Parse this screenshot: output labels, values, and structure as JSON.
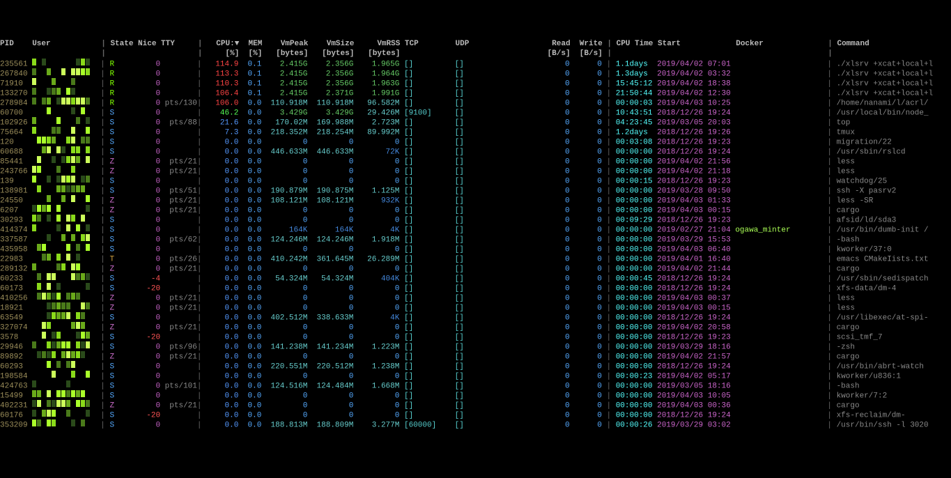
{
  "columns": [
    "PID",
    "User",
    "State",
    "Nice",
    "TTY",
    "CPU:▼",
    "MEM",
    "VmPeak",
    "VmSize",
    "VmRSS",
    "TCP",
    "UDP",
    "Read",
    "Write",
    "CPU Time",
    "Start",
    "Docker",
    "Command"
  ],
  "subheaders": {
    "cpu": "[%]",
    "mem": "[%]",
    "vmpeak": "[bytes]",
    "vmsize": "[bytes]",
    "vmrss": "[bytes]",
    "read": "[B/s]",
    "write": "[B/s]"
  },
  "rows": [
    {
      "pid": "235561",
      "state": "R",
      "nice": "0",
      "tty": "",
      "cpu": "114.9",
      "cpuClass": "cpu-hi",
      "mem": "0.1",
      "vmpeak": "2.415G",
      "vmsize": "2.356G",
      "vmrss": "1.965G",
      "tcp": "[]",
      "udp": "[]",
      "read": "0",
      "write": "0",
      "cputime": "1.1days",
      "start": "2019/04/02 07:01",
      "docker": "",
      "cmd": "./xlsrv +xcat+local+l"
    },
    {
      "pid": "267840",
      "state": "R",
      "nice": "0",
      "tty": "",
      "cpu": "113.3",
      "cpuClass": "cpu-hi",
      "mem": "0.1",
      "vmpeak": "2.415G",
      "vmsize": "2.356G",
      "vmrss": "1.964G",
      "tcp": "[]",
      "udp": "[]",
      "read": "0",
      "write": "0",
      "cputime": "1.3days",
      "start": "2019/04/02 03:32",
      "docker": "",
      "cmd": "./xlsrv +xcat+local+l"
    },
    {
      "pid": "71910",
      "state": "R",
      "nice": "0",
      "tty": "",
      "cpu": "110.3",
      "cpuClass": "cpu-hi",
      "mem": "0.1",
      "vmpeak": "2.415G",
      "vmsize": "2.356G",
      "vmrss": "1.963G",
      "tcp": "[]",
      "udp": "[]",
      "read": "0",
      "write": "0",
      "cputime": "15:45:12",
      "start": "2019/04/02 18:38",
      "docker": "",
      "cmd": "./xlsrv +xcat+local+l"
    },
    {
      "pid": "133270",
      "state": "R",
      "nice": "0",
      "tty": "",
      "cpu": "106.4",
      "cpuClass": "cpu-hi",
      "mem": "0.1",
      "vmpeak": "2.415G",
      "vmsize": "2.371G",
      "vmrss": "1.991G",
      "tcp": "[]",
      "udp": "[]",
      "read": "0",
      "write": "0",
      "cputime": "21:50:44",
      "start": "2019/04/02 12:30",
      "docker": "",
      "cmd": "./xlsrv +xcat+local+l"
    },
    {
      "pid": "278984",
      "state": "R",
      "nice": "0",
      "tty": "pts/130",
      "cpu": "106.0",
      "cpuClass": "cpu-hi",
      "mem": "0.0",
      "vmpeak": "110.918M",
      "vmsize": "110.918M",
      "vmrss": "96.582M",
      "tcp": "[]",
      "udp": "[]",
      "read": "0",
      "write": "0",
      "cputime": "00:00:03",
      "start": "2019/04/03 10:25",
      "docker": "",
      "cmd": "/home/nanami/l/acrl/"
    },
    {
      "pid": "60700",
      "state": "S",
      "nice": "0",
      "tty": "",
      "cpu": "46.2",
      "cpuClass": "cpu-md",
      "mem": "0.0",
      "vmpeak": "3.429G",
      "vmsize": "3.429G",
      "vmrss": "29.426M",
      "tcp": "[9100]",
      "udp": "[]",
      "read": "0",
      "write": "0",
      "cputime": "10:43:51",
      "start": "2018/12/26 19:24",
      "docker": "",
      "cmd": "/usr/local/bin/node_"
    },
    {
      "pid": "102926",
      "state": "S",
      "nice": "0",
      "tty": "pts/88",
      "cpu": "21.6",
      "cpuClass": "cpu-lo",
      "mem": "0.0",
      "vmpeak": "170.02M",
      "vmsize": "169.988M",
      "vmrss": "2.723M",
      "tcp": "[]",
      "udp": "[]",
      "read": "0",
      "write": "0",
      "cputime": "04:23:45",
      "start": "2019/03/05 20:03",
      "docker": "",
      "cmd": "top"
    },
    {
      "pid": "75664",
      "state": "S",
      "nice": "0",
      "tty": "",
      "cpu": "7.3",
      "cpuClass": "cpu-lo",
      "mem": "0.0",
      "vmpeak": "218.352M",
      "vmsize": "218.254M",
      "vmrss": "89.992M",
      "tcp": "[]",
      "udp": "[]",
      "read": "0",
      "write": "0",
      "cputime": "1.2days",
      "start": "2018/12/26 19:26",
      "docker": "",
      "cmd": "tmux"
    },
    {
      "pid": "120",
      "state": "S",
      "nice": "0",
      "tty": "",
      "cpu": "0.0",
      "cpuClass": "cpu-lo",
      "mem": "0.0",
      "vmpeak": "0",
      "vmsize": "0",
      "vmrss": "0",
      "tcp": "[]",
      "udp": "[]",
      "read": "0",
      "write": "0",
      "cputime": "00:03:08",
      "start": "2018/12/26 19:23",
      "docker": "",
      "cmd": "migration/22"
    },
    {
      "pid": "60688",
      "state": "S",
      "nice": "0",
      "tty": "",
      "cpu": "0.0",
      "cpuClass": "cpu-lo",
      "mem": "0.0",
      "vmpeak": "446.633M",
      "vmsize": "446.633M",
      "vmrss": "72K",
      "tcp": "[]",
      "udp": "[]",
      "read": "0",
      "write": "0",
      "cputime": "00:00:00",
      "start": "2018/12/26 19:24",
      "docker": "",
      "cmd": "/usr/sbin/rslcd"
    },
    {
      "pid": "85441",
      "state": "Z",
      "nice": "0",
      "tty": "pts/21",
      "cpu": "0.0",
      "cpuClass": "cpu-lo",
      "mem": "0.0",
      "vmpeak": "0",
      "vmsize": "0",
      "vmrss": "0",
      "tcp": "[]",
      "udp": "[]",
      "read": "0",
      "write": "0",
      "cputime": "00:00:00",
      "start": "2019/04/02 21:56",
      "docker": "",
      "cmd": "less"
    },
    {
      "pid": "243766",
      "state": "Z",
      "nice": "0",
      "tty": "pts/21",
      "cpu": "0.0",
      "cpuClass": "cpu-lo",
      "mem": "0.0",
      "vmpeak": "0",
      "vmsize": "0",
      "vmrss": "0",
      "tcp": "[]",
      "udp": "[]",
      "read": "0",
      "write": "0",
      "cputime": "00:00:00",
      "start": "2019/04/02 21:18",
      "docker": "",
      "cmd": "less"
    },
    {
      "pid": "139",
      "state": "S",
      "nice": "0",
      "tty": "",
      "cpu": "0.0",
      "cpuClass": "cpu-lo",
      "mem": "0.0",
      "vmpeak": "0",
      "vmsize": "0",
      "vmrss": "0",
      "tcp": "[]",
      "udp": "[]",
      "read": "0",
      "write": "0",
      "cputime": "00:00:15",
      "start": "2018/12/26 19:23",
      "docker": "",
      "cmd": "watchdog/25"
    },
    {
      "pid": "138981",
      "state": "S",
      "nice": "0",
      "tty": "pts/51",
      "cpu": "0.0",
      "cpuClass": "cpu-lo",
      "mem": "0.0",
      "vmpeak": "190.879M",
      "vmsize": "190.875M",
      "vmrss": "1.125M",
      "tcp": "[]",
      "udp": "[]",
      "read": "0",
      "write": "0",
      "cputime": "00:00:00",
      "start": "2019/03/28 09:50",
      "docker": "",
      "cmd": "ssh -X pasrv2"
    },
    {
      "pid": "24550",
      "state": "Z",
      "nice": "0",
      "tty": "pts/21",
      "cpu": "0.0",
      "cpuClass": "cpu-lo",
      "mem": "0.0",
      "vmpeak": "108.121M",
      "vmsize": "108.121M",
      "vmrss": "932K",
      "tcp": "[]",
      "udp": "[]",
      "read": "0",
      "write": "0",
      "cputime": "00:00:00",
      "start": "2019/04/03 01:33",
      "docker": "",
      "cmd": "less -SR"
    },
    {
      "pid": "6207",
      "state": "Z",
      "nice": "0",
      "tty": "pts/21",
      "cpu": "0.0",
      "cpuClass": "cpu-lo",
      "mem": "0.0",
      "vmpeak": "0",
      "vmsize": "0",
      "vmrss": "0",
      "tcp": "[]",
      "udp": "[]",
      "read": "0",
      "write": "0",
      "cputime": "00:00:00",
      "start": "2019/04/03 00:15",
      "docker": "",
      "cmd": "cargo"
    },
    {
      "pid": "30293",
      "state": "S",
      "nice": "0",
      "tty": "",
      "cpu": "0.0",
      "cpuClass": "cpu-lo",
      "mem": "0.0",
      "vmpeak": "0",
      "vmsize": "0",
      "vmrss": "0",
      "tcp": "[]",
      "udp": "[]",
      "read": "0",
      "write": "0",
      "cputime": "00:09:29",
      "start": "2018/12/26 19:23",
      "docker": "",
      "cmd": "afsid/ld/sda3"
    },
    {
      "pid": "414374",
      "state": "S",
      "nice": "0",
      "tty": "",
      "cpu": "0.0",
      "cpuClass": "cpu-lo",
      "mem": "0.0",
      "vmpeak": "164K",
      "vmsize": "164K",
      "vmrss": "4K",
      "tcp": "[]",
      "udp": "[]",
      "read": "0",
      "write": "0",
      "cputime": "00:00:00",
      "start": "2019/02/27 21:04",
      "docker": "ogawa_minter",
      "cmd": "/usr/bin/dumb-init /"
    },
    {
      "pid": "337587",
      "state": "S",
      "nice": "0",
      "tty": "pts/62",
      "cpu": "0.0",
      "cpuClass": "cpu-lo",
      "mem": "0.0",
      "vmpeak": "124.246M",
      "vmsize": "124.246M",
      "vmrss": "1.918M",
      "tcp": "[]",
      "udp": "[]",
      "read": "0",
      "write": "0",
      "cputime": "00:00:00",
      "start": "2019/03/29 15:53",
      "docker": "",
      "cmd": "-bash"
    },
    {
      "pid": "435958",
      "state": "S",
      "nice": "0",
      "tty": "",
      "cpu": "0.0",
      "cpuClass": "cpu-lo",
      "mem": "0.0",
      "vmpeak": "0",
      "vmsize": "0",
      "vmrss": "0",
      "tcp": "[]",
      "udp": "[]",
      "read": "0",
      "write": "0",
      "cputime": "00:00:00",
      "start": "2019/04/03 06:40",
      "docker": "",
      "cmd": "kworker/37:0"
    },
    {
      "pid": "22983",
      "state": "T",
      "nice": "0",
      "tty": "pts/26",
      "cpu": "0.0",
      "cpuClass": "cpu-lo",
      "mem": "0.0",
      "vmpeak": "410.242M",
      "vmsize": "361.645M",
      "vmrss": "26.289M",
      "tcp": "[]",
      "udp": "[]",
      "read": "0",
      "write": "0",
      "cputime": "00:00:00",
      "start": "2019/04/01 16:40",
      "docker": "",
      "cmd": "emacs CMakeIists.txt"
    },
    {
      "pid": "289132",
      "state": "Z",
      "nice": "0",
      "tty": "pts/21",
      "cpu": "0.0",
      "cpuClass": "cpu-lo",
      "mem": "0.0",
      "vmpeak": "0",
      "vmsize": "0",
      "vmrss": "0",
      "tcp": "[]",
      "udp": "[]",
      "read": "0",
      "write": "0",
      "cputime": "00:00:00",
      "start": "2019/04/02 21:44",
      "docker": "",
      "cmd": "cargo"
    },
    {
      "pid": "60233",
      "state": "S",
      "nice": "-4",
      "tty": "",
      "cpu": "0.0",
      "cpuClass": "cpu-lo",
      "mem": "0.0",
      "vmpeak": "54.324M",
      "vmsize": "54.324M",
      "vmrss": "404K",
      "tcp": "[]",
      "udp": "[]",
      "read": "0",
      "write": "0",
      "cputime": "00:00:45",
      "start": "2018/12/26 19:24",
      "docker": "",
      "cmd": "/usr/sbin/sedispatch"
    },
    {
      "pid": "60173",
      "state": "S",
      "nice": "-20",
      "tty": "",
      "cpu": "0.0",
      "cpuClass": "cpu-lo",
      "mem": "0.0",
      "vmpeak": "0",
      "vmsize": "0",
      "vmrss": "0",
      "tcp": "[]",
      "udp": "[]",
      "read": "0",
      "write": "0",
      "cputime": "00:00:00",
      "start": "2018/12/26 19:24",
      "docker": "",
      "cmd": "xfs-data/dm-4"
    },
    {
      "pid": "410256",
      "state": "Z",
      "nice": "0",
      "tty": "pts/21",
      "cpu": "0.0",
      "cpuClass": "cpu-lo",
      "mem": "0.0",
      "vmpeak": "0",
      "vmsize": "0",
      "vmrss": "0",
      "tcp": "[]",
      "udp": "[]",
      "read": "0",
      "write": "0",
      "cputime": "00:00:00",
      "start": "2019/04/03 00:37",
      "docker": "",
      "cmd": "less"
    },
    {
      "pid": "18921",
      "state": "Z",
      "nice": "0",
      "tty": "pts/21",
      "cpu": "0.0",
      "cpuClass": "cpu-lo",
      "mem": "0.0",
      "vmpeak": "0",
      "vmsize": "0",
      "vmrss": "0",
      "tcp": "[]",
      "udp": "[]",
      "read": "0",
      "write": "0",
      "cputime": "00:00:00",
      "start": "2019/04/03 00:15",
      "docker": "",
      "cmd": "less"
    },
    {
      "pid": "63549",
      "state": "S",
      "nice": "0",
      "tty": "",
      "cpu": "0.0",
      "cpuClass": "cpu-lo",
      "mem": "0.0",
      "vmpeak": "402.512M",
      "vmsize": "338.633M",
      "vmrss": "4K",
      "tcp": "[]",
      "udp": "[]",
      "read": "0",
      "write": "0",
      "cputime": "00:00:00",
      "start": "2018/12/26 19:24",
      "docker": "",
      "cmd": "/usr/libexec/at-spi-"
    },
    {
      "pid": "327074",
      "state": "Z",
      "nice": "0",
      "tty": "pts/21",
      "cpu": "0.0",
      "cpuClass": "cpu-lo",
      "mem": "0.0",
      "vmpeak": "0",
      "vmsize": "0",
      "vmrss": "0",
      "tcp": "[]",
      "udp": "[]",
      "read": "0",
      "write": "0",
      "cputime": "00:00:00",
      "start": "2019/04/02 20:58",
      "docker": "",
      "cmd": "cargo"
    },
    {
      "pid": "3578",
      "state": "S",
      "nice": "-20",
      "tty": "",
      "cpu": "0.0",
      "cpuClass": "cpu-lo",
      "mem": "0.0",
      "vmpeak": "0",
      "vmsize": "0",
      "vmrss": "0",
      "tcp": "[]",
      "udp": "[]",
      "read": "0",
      "write": "0",
      "cputime": "00:00:00",
      "start": "2018/12/26 19:23",
      "docker": "",
      "cmd": "scsi_tmf_7"
    },
    {
      "pid": "29946",
      "state": "S",
      "nice": "0",
      "tty": "pts/96",
      "cpu": "0.0",
      "cpuClass": "cpu-lo",
      "mem": "0.0",
      "vmpeak": "141.238M",
      "vmsize": "141.234M",
      "vmrss": "1.223M",
      "tcp": "[]",
      "udp": "[]",
      "read": "0",
      "write": "0",
      "cputime": "00:00:00",
      "start": "2019/03/29 18:16",
      "docker": "",
      "cmd": "-zsh"
    },
    {
      "pid": "89892",
      "state": "Z",
      "nice": "0",
      "tty": "pts/21",
      "cpu": "0.0",
      "cpuClass": "cpu-lo",
      "mem": "0.0",
      "vmpeak": "0",
      "vmsize": "0",
      "vmrss": "0",
      "tcp": "[]",
      "udp": "[]",
      "read": "0",
      "write": "0",
      "cputime": "00:00:00",
      "start": "2019/04/02 21:57",
      "docker": "",
      "cmd": "cargo"
    },
    {
      "pid": "60293",
      "state": "S",
      "nice": "0",
      "tty": "",
      "cpu": "0.0",
      "cpuClass": "cpu-lo",
      "mem": "0.0",
      "vmpeak": "220.551M",
      "vmsize": "220.512M",
      "vmrss": "1.238M",
      "tcp": "[]",
      "udp": "[]",
      "read": "0",
      "write": "0",
      "cputime": "00:00:00",
      "start": "2018/12/26 19:24",
      "docker": "",
      "cmd": "/usr/bin/abrt-watch"
    },
    {
      "pid": "198584",
      "state": "S",
      "nice": "0",
      "tty": "",
      "cpu": "0.0",
      "cpuClass": "cpu-lo",
      "mem": "0.0",
      "vmpeak": "0",
      "vmsize": "0",
      "vmrss": "0",
      "tcp": "[]",
      "udp": "[]",
      "read": "0",
      "write": "0",
      "cputime": "00:00:23",
      "start": "2019/04/02 05:17",
      "docker": "",
      "cmd": "kworker/u836:1"
    },
    {
      "pid": "424763",
      "state": "S",
      "nice": "0",
      "tty": "pts/101",
      "cpu": "0.0",
      "cpuClass": "cpu-lo",
      "mem": "0.0",
      "vmpeak": "124.516M",
      "vmsize": "124.484M",
      "vmrss": "1.668M",
      "tcp": "[]",
      "udp": "[]",
      "read": "0",
      "write": "0",
      "cputime": "00:00:00",
      "start": "2019/03/05 18:16",
      "docker": "",
      "cmd": "-bash"
    },
    {
      "pid": "15499",
      "state": "S",
      "nice": "0",
      "tty": "",
      "cpu": "0.0",
      "cpuClass": "cpu-lo",
      "mem": "0.0",
      "vmpeak": "0",
      "vmsize": "0",
      "vmrss": "0",
      "tcp": "[]",
      "udp": "[]",
      "read": "0",
      "write": "0",
      "cputime": "00:00:00",
      "start": "2019/04/03 10:05",
      "docker": "",
      "cmd": "kworker/7:2"
    },
    {
      "pid": "402231",
      "state": "Z",
      "nice": "0",
      "tty": "pts/21",
      "cpu": "0.0",
      "cpuClass": "cpu-lo",
      "mem": "0.0",
      "vmpeak": "0",
      "vmsize": "0",
      "vmrss": "0",
      "tcp": "[]",
      "udp": "[]",
      "read": "0",
      "write": "0",
      "cputime": "00:00:00",
      "start": "2019/04/03 00:36",
      "docker": "",
      "cmd": "cargo"
    },
    {
      "pid": "60176",
      "state": "S",
      "nice": "-20",
      "tty": "",
      "cpu": "0.0",
      "cpuClass": "cpu-lo",
      "mem": "0.0",
      "vmpeak": "0",
      "vmsize": "0",
      "vmrss": "0",
      "tcp": "[]",
      "udp": "[]",
      "read": "0",
      "write": "0",
      "cputime": "00:00:00",
      "start": "2018/12/26 19:24",
      "docker": "",
      "cmd": "xfs-reclaim/dm-"
    },
    {
      "pid": "353209",
      "state": "S",
      "nice": "0",
      "tty": "",
      "cpu": "0.0",
      "cpuClass": "cpu-lo",
      "mem": "0.0",
      "vmpeak": "188.813M",
      "vmsize": "188.809M",
      "vmrss": "3.277M",
      "tcp": "[60000]",
      "udp": "[]",
      "read": "0",
      "write": "0",
      "cputime": "00:00:26",
      "start": "2019/03/29 03:02",
      "docker": "",
      "cmd": "/usr/bin/ssh -l 3020"
    }
  ]
}
